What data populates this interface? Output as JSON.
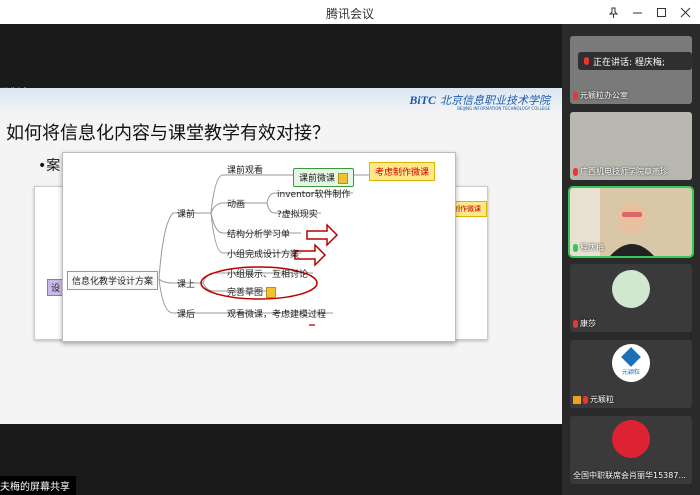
{
  "window": {
    "title": "腾讯会议"
  },
  "recording": {
    "label": "录制中"
  },
  "slide": {
    "title": "如何将信息化内容与课堂教学有效对接？",
    "bullet": "•案",
    "logo": {
      "abbr": "BiTC",
      "cn": "北京信息职业技术学院",
      "en": "BEIJING INFORMATION TECHNOLOGY COLLEGE"
    }
  },
  "mindmap": {
    "root": "信息化教学设计方案",
    "back_left": "设",
    "back_right": "制作微课",
    "branch_pre": "课前",
    "branch_in": "课上",
    "branch_post": "课后",
    "pre_watch": "课前观看",
    "pre_micro": "课前微课",
    "pre_micro_note": "考虑制作微课",
    "pre_anim": "动画",
    "pre_inventor": "inventor软件制作",
    "pre_vr": "?虚拟现实",
    "pre_sheet": "结构分析学习单",
    "pre_design": "小组完成设计方案",
    "in_discuss": "小组展示、互相讨论",
    "in_sketch": "完善草图",
    "post_text": "观看微课，考虑建模过程"
  },
  "participants": {
    "speaking_label": "正在讲话: 程庆梅;",
    "tiles": [
      {
        "name": "元颖粒办公室",
        "mic": "off"
      },
      {
        "name": "广西机电技师学院章燕珍",
        "mic": "off"
      },
      {
        "name": "程庆梅",
        "mic": "on"
      },
      {
        "name": "康莎",
        "mic": "off"
      },
      {
        "name": "元颖粒",
        "mic": "off",
        "logo_text": "元颖粒"
      },
      {
        "name": "全国中职联席会肖丽华15387...",
        "mic": "none"
      }
    ]
  },
  "share_label": "夫梅的屏幕共享"
}
